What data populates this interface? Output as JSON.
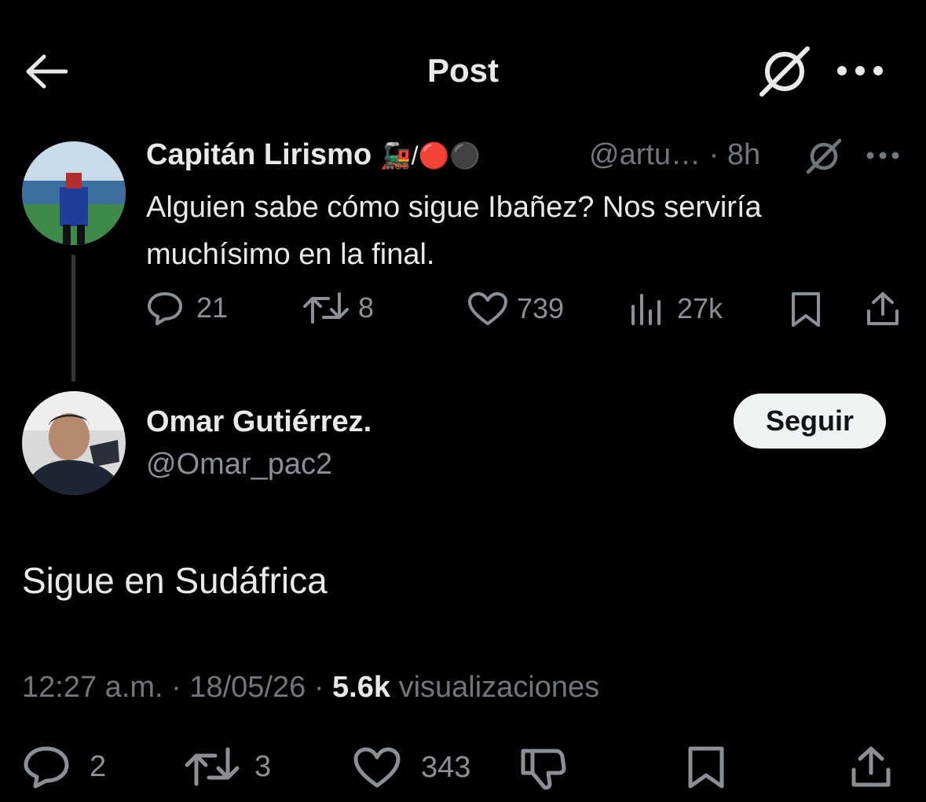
{
  "header": {
    "title": "Post",
    "back_icon": "arrow-left-icon",
    "grok_icon": "grok-icon",
    "more_icon": "more-icon"
  },
  "parent_tweet": {
    "display_name": "Capitán Lirismo",
    "name_emojis": "🚂/🔴⚫",
    "handle_time": "@artu… · 8h",
    "text": "Alguien sabe cómo sigue Ibañez? Nos serviría muchísimo en la final.",
    "actions": {
      "replies": "21",
      "reposts": "8",
      "likes": "739",
      "views": "27k"
    }
  },
  "reply_tweet": {
    "display_name": "Omar Gutiérrez.",
    "handle": "@Omar_pac2",
    "follow_label": "Seguir",
    "text": "Sigue en Sudáfrica",
    "time": "12:27 a.m.",
    "date": "18/05/26",
    "views_count": "5.6k",
    "views_label": "visualizaciones",
    "actions": {
      "replies": "2",
      "reposts": "3",
      "likes": "343"
    }
  },
  "colors": {
    "background": "#000000",
    "text": "#e7e9ea",
    "secondary": "#71767b",
    "follow_button": "#eff3f4"
  }
}
